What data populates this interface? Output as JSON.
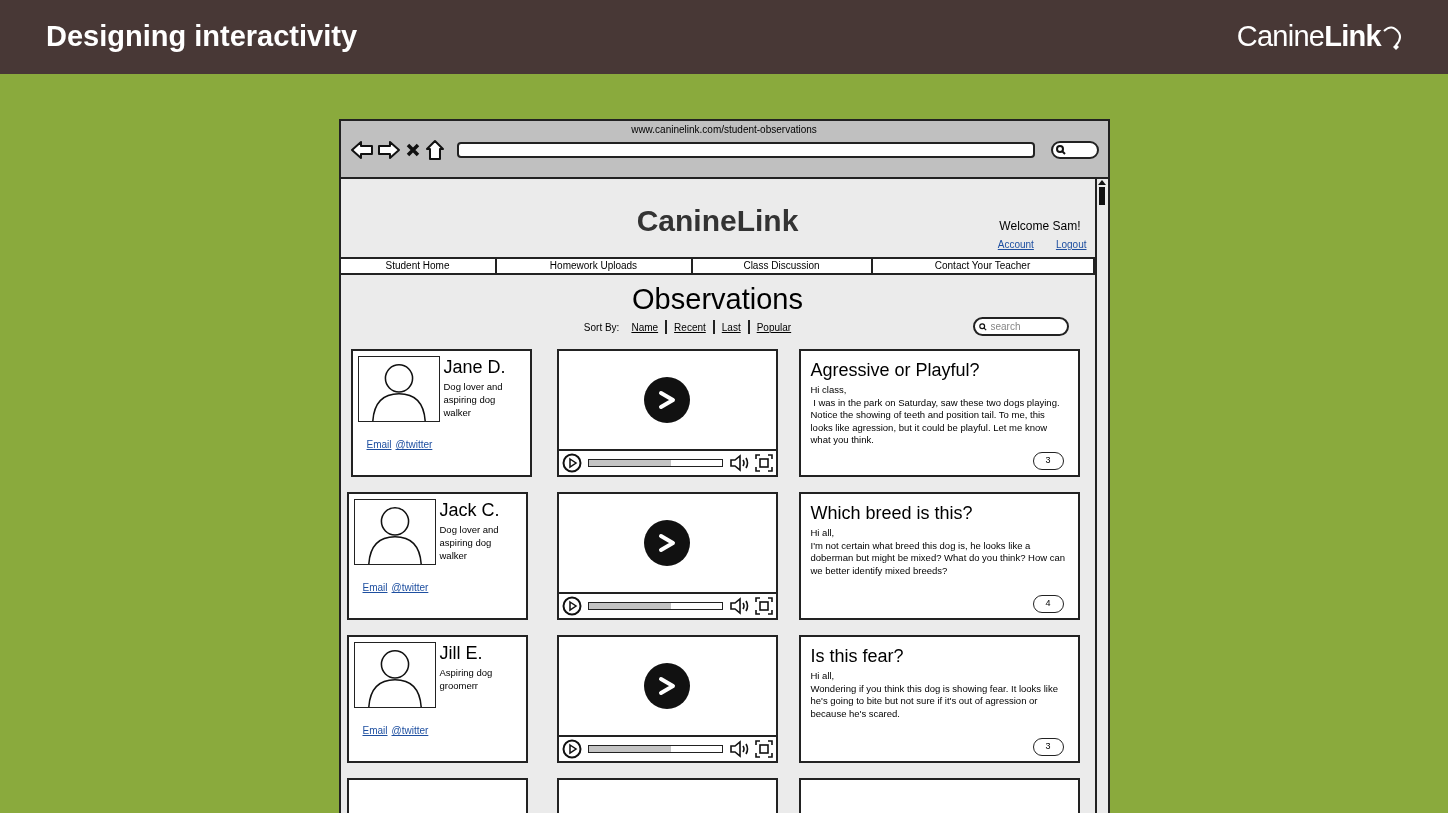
{
  "slide": {
    "title": "Designing interactivity",
    "logo": "Canine**Link**"
  },
  "browser": {
    "url": "www.caninelink.com/student-observations"
  },
  "site": {
    "title": "CanineLink",
    "welcome": "Welcome Sam!",
    "links": [
      "Account",
      "Logout"
    ]
  },
  "nav": [
    {
      "label": "Student Home"
    },
    {
      "label": "Homework Uploads"
    },
    {
      "label": "Class Discussion"
    },
    {
      "label": "Contact Your Teacher"
    }
  ],
  "page": {
    "heading": "Observations",
    "sort_label": "Sort By:",
    "sort_options": [
      "Name",
      "Recent",
      "Last",
      "Popular"
    ],
    "search": {
      "placeholder": "search"
    }
  },
  "posts": [
    {
      "author": {
        "name": "Jane D.",
        "bio": "Dog lover and aspiring dog walker",
        "links": [
          "Email",
          "@twitter"
        ]
      },
      "video": {
        "level": 0.62
      },
      "post": {
        "title": "Agressive or Playful?",
        "greeting": "Hi class,",
        "body": " I was in the park on Saturday, saw these two dogs playing. Notice the showing of teeth and position tail. To me, this looks like agression, but it could be playful. Let me know what you think.",
        "comments": "3"
      }
    },
    {
      "author": {
        "name": "Jack C.",
        "bio": "Dog lover and aspiring dog walker",
        "links": [
          "Email",
          "@twitter"
        ]
      },
      "video": {
        "level": 0.62
      },
      "post": {
        "title": "Which breed is this?",
        "greeting": "Hi all,",
        "body": "I'm not certain what breed this dog is, he looks like a doberman but might be mixed? What do you think? How can we better identify mixed breeds?",
        "comments": "4"
      }
    },
    {
      "author": {
        "name": "Jill E.",
        "bio": "Aspiring dog groomerr",
        "links": [
          "Email",
          "@twitter"
        ]
      },
      "video": {
        "level": 0.62
      },
      "post": {
        "title": "Is this fear?",
        "greeting": "Hi all,",
        "body": "Wondering if you think this dog is showing fear. It looks like he's going to bite but not sure if it's out of agression or because he's scared.",
        "comments": "3"
      }
    }
  ]
}
